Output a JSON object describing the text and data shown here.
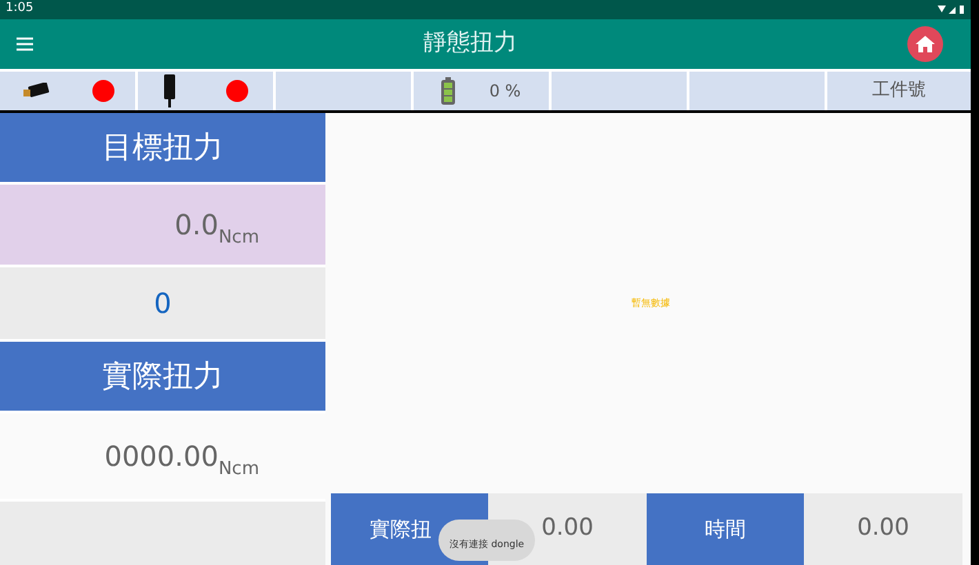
{
  "status_bar": {
    "time": "1:05"
  },
  "app_bar": {
    "title": "靜態扭力"
  },
  "info_strip": {
    "dongle_connected": false,
    "device_connected": false,
    "battery_reading": "0 %",
    "work_id_label": "工件號"
  },
  "target": {
    "label": "目標扭力",
    "value": "0.0",
    "unit": "Ncm",
    "count": "0"
  },
  "actual": {
    "label": "實際扭力",
    "value": "0000.00",
    "unit": "Ncm"
  },
  "chart": {
    "empty_message": "暫無數據"
  },
  "bottom_row": [
    {
      "kind": "label",
      "text": "實際扭"
    },
    {
      "kind": "value",
      "text": "0.00"
    },
    {
      "kind": "label",
      "text": "時間"
    },
    {
      "kind": "value",
      "text": "0.00"
    }
  ],
  "toast": {
    "message": "沒有連接 dongle"
  }
}
